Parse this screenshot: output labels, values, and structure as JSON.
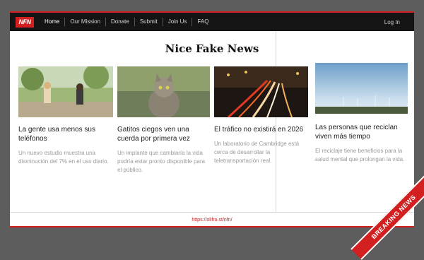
{
  "brand": {
    "logo_text": "NFN",
    "site_title": "Nice Fake News"
  },
  "nav": {
    "items": [
      "Home",
      "Our Mission",
      "Donate",
      "Submit",
      "Join Us",
      "FAQ"
    ],
    "login": "Log In"
  },
  "articles": [
    {
      "headline": "La gente usa menos sus teléfonos",
      "summary": "Un nuevo estudio muestra una disminución del 7% en el uso diario."
    },
    {
      "headline": "Gatitos ciegos ven una cuerda por primera vez",
      "summary": "Un implante que cambiaría la vida podría estar pronto disponible para el público."
    },
    {
      "headline": "El tráfico no existirá en 2026",
      "summary": "Un laboratorio de Cambridge está cerca de desarrollar la teletransportación real."
    },
    {
      "headline": "Las personas que reciclan viven más tiempo",
      "summary": "El reciclaje tiene beneficios para la salud mental que prolongan la vida."
    }
  ],
  "footer": {
    "link": "https://olifro.st/nfn/"
  },
  "ribbon": {
    "text": "BREAKING NEWS"
  },
  "colors": {
    "accent": "#d21f1f",
    "nav_bg": "#141414"
  }
}
